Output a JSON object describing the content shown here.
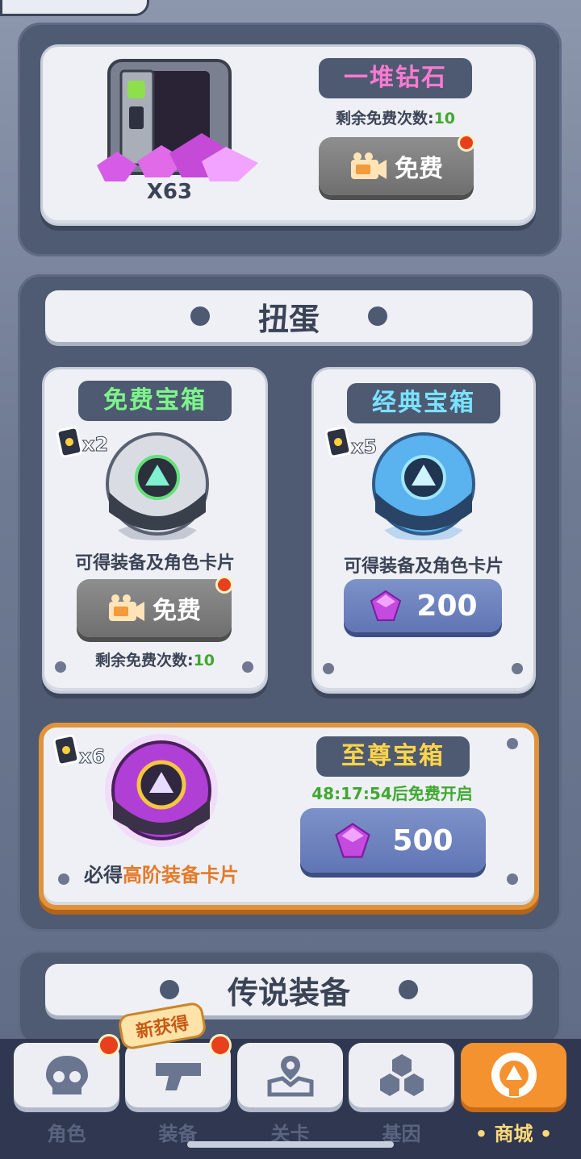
{
  "diamond_offer": {
    "title": "一堆钻石",
    "remaining_label": "剩余免费次数:",
    "remaining_count": "10",
    "quantity": "X63",
    "free_button": "免费"
  },
  "gacha": {
    "section_title": "扭蛋",
    "free_chest": {
      "title": "免费宝箱",
      "multiplier": "x2",
      "desc": "可得装备及角色卡片",
      "button": "免费",
      "remaining_label": "剩余免费次数:",
      "remaining_count": "10"
    },
    "classic_chest": {
      "title": "经典宝箱",
      "multiplier": "x5",
      "desc": "可得装备及角色卡片",
      "price": "200"
    },
    "supreme_chest": {
      "title": "至尊宝箱",
      "multiplier": "x6",
      "timer": "48:17:54后免费开启",
      "desc_prefix": "必得",
      "desc_highlight": "高阶装备卡片",
      "price": "500"
    }
  },
  "legend_section": {
    "title": "传说装备"
  },
  "nav": {
    "new_badge": "新获得",
    "items": [
      {
        "label": "角色",
        "icon": "skull-icon"
      },
      {
        "label": "装备",
        "icon": "gun-icon"
      },
      {
        "label": "关卡",
        "icon": "map-icon"
      },
      {
        "label": "基因",
        "icon": "hexagon-icon"
      },
      {
        "label": "商城",
        "icon": "shop-icon"
      }
    ],
    "active_index": 4
  },
  "colors": {
    "accent": "#f49230",
    "panel": "#4f5b73",
    "button_blue": "#6075b4",
    "red_dot": "#e8401c"
  }
}
